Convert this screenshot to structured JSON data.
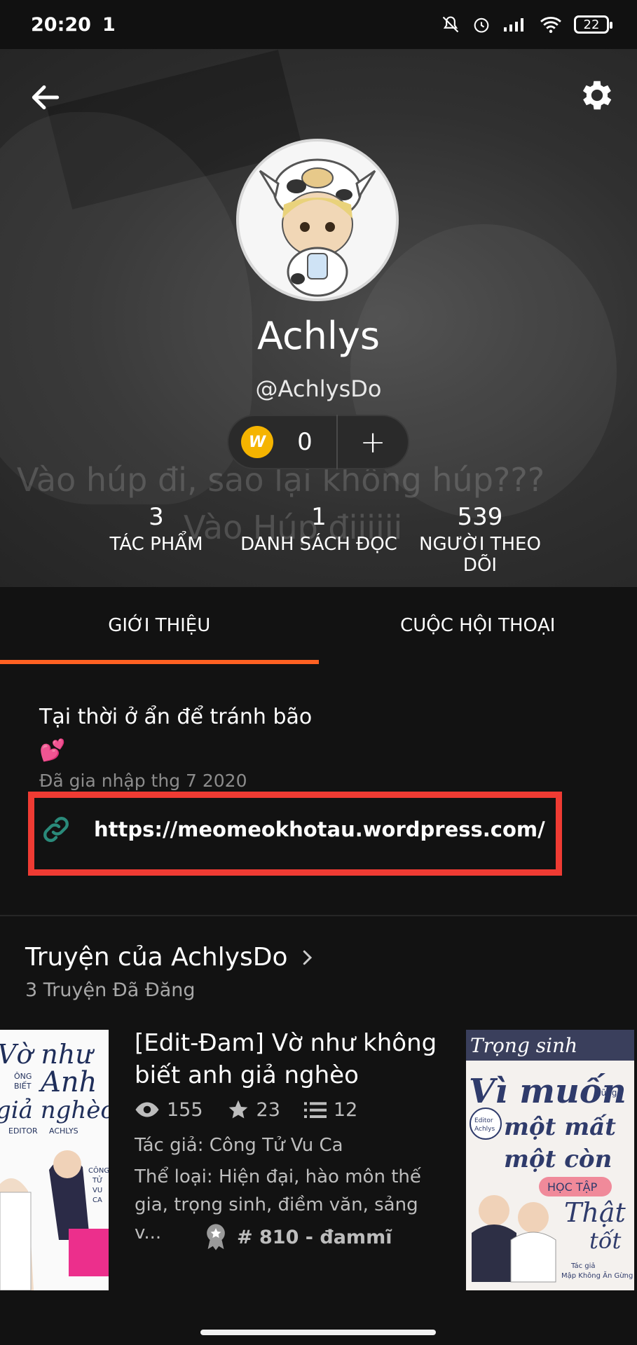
{
  "status_bar": {
    "time": "20:20",
    "notif": "1",
    "battery": "22"
  },
  "profile": {
    "display_name": "Achlys",
    "username": "@AchlysDo",
    "coins": "0",
    "background_text_1": "Vào húp đi, sao lại không húp???",
    "background_text_2": "Vào Húp điiiiii",
    "stats": [
      {
        "value": "3",
        "label": "TÁC PHẨM"
      },
      {
        "value": "1",
        "label": "DANH SÁCH ĐỌC"
      },
      {
        "value": "539",
        "label": "NGƯỜI THEO DÕI"
      }
    ]
  },
  "tabs": [
    {
      "label": "GIỚI THIỆU",
      "active": true
    },
    {
      "label": "CUỘC HỘI THOẠI",
      "active": false
    }
  ],
  "about": {
    "tagline": "Tại thời ở ẩn để tránh bão",
    "emoji": "💕",
    "joined": "Đã gia nhập thg 7 2020",
    "link": "https://meomeokhotau.wordpress.com/"
  },
  "stories": {
    "title": "Truyện của AchlysDo",
    "subtitle": "3 Truyện Đã Đăng",
    "featured": {
      "title": "[Edit-Đam] Vờ như không biết anh giả nghèo",
      "reads": "155",
      "votes": "23",
      "parts": "12",
      "author": "Tác giả: Công Tử Vu Ca",
      "genre": "Thể loại: Hiện đại, hào môn thế gia, trọng sinh, điềm văn, sảng v...",
      "rank": "# 810 - đammĩ"
    },
    "left_cover_text": [
      "Vờ như",
      "ÔNG",
      "BIẾT",
      "Anh",
      "giả nghèo",
      "EDITOR",
      "ACHLYS",
      "CÔNG",
      "TỬ",
      "VU",
      "CA"
    ],
    "right_cover_text": [
      "Trọng sinh",
      "Vì muốn",
      "một mất",
      "một còn",
      "HỌC TẬP",
      "Thật",
      "tốt",
      "Editor",
      "Achlys",
      "cũng",
      "Tác giả",
      "Mập Không Ăn Gừng"
    ]
  },
  "colors": {
    "accent": "#ff6122",
    "highlight": "#ef3b33",
    "coin": "#f5b400",
    "link_icon": "#2a8a7a"
  }
}
